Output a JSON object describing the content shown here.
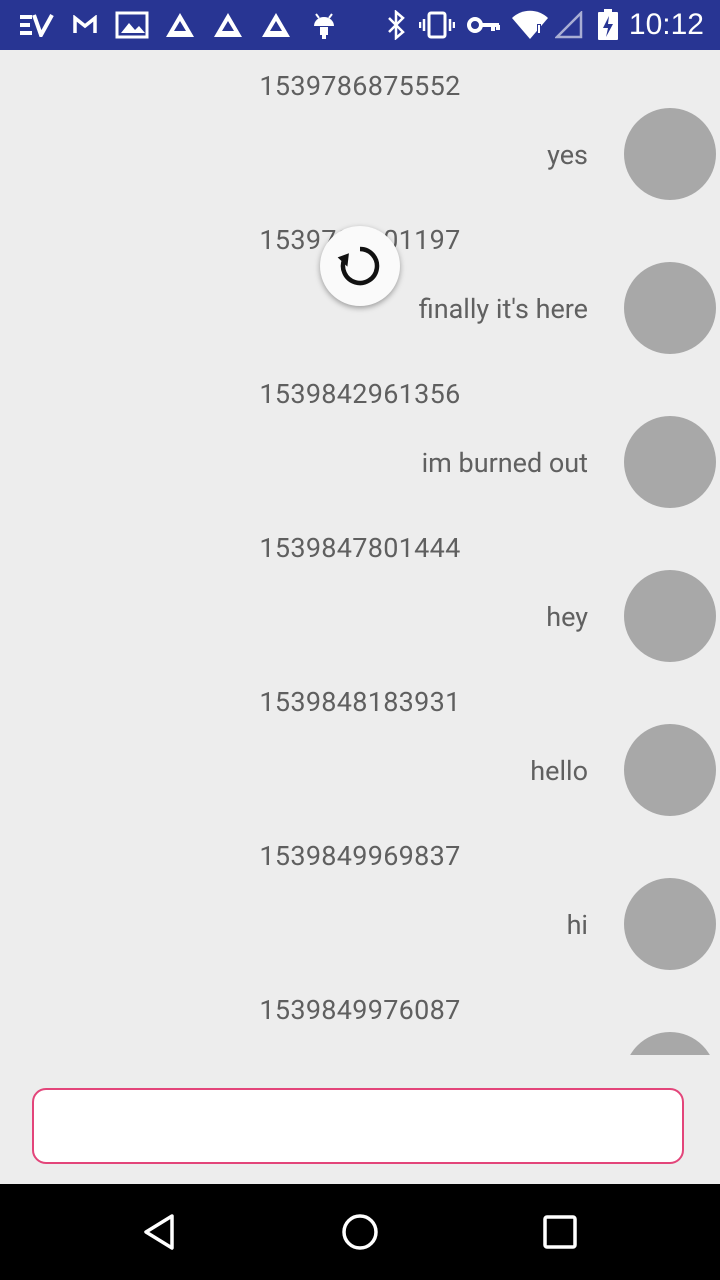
{
  "status_bar": {
    "time": "10:12",
    "left_icons": [
      "expressvpn-icon",
      "gmail-icon",
      "photos-icon",
      "triangle-app-icon",
      "triangle-app-icon",
      "triangle-app-icon",
      "android-icon"
    ],
    "right_icons": [
      "bluetooth-icon",
      "vibrate-icon",
      "vpn-key-icon",
      "wifi-icon",
      "cell-signal-icon",
      "battery-charging-icon"
    ],
    "color": "#283593"
  },
  "messages": [
    {
      "timestamp": "1539786875552",
      "text": "yes"
    },
    {
      "timestamp": "1539786901197",
      "text": "finally it's here"
    },
    {
      "timestamp": "1539842961356",
      "text": "im burned out"
    },
    {
      "timestamp": "1539847801444",
      "text": "hey"
    },
    {
      "timestamp": "1539848183931",
      "text": "hello"
    },
    {
      "timestamp": "1539849969837",
      "text": "hi"
    },
    {
      "timestamp": "1539849976087",
      "text": ""
    }
  ],
  "input": {
    "placeholder": "",
    "value": "",
    "border_color": "#e3457a"
  },
  "nav": {
    "icons": [
      "back-icon",
      "home-icon",
      "recents-icon"
    ]
  }
}
